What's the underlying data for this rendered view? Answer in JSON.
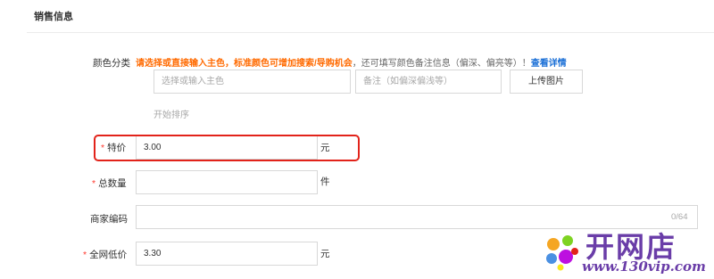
{
  "section": {
    "title": "销售信息"
  },
  "color_category": {
    "label": "颜色分类",
    "hint_orange": "请选择或直接输入主色，标准颜色可增加搜索/导购机会",
    "hint_gray": "，还可填写颜色备注信息（偏深、偏亮等）！",
    "hint_link": "查看详情",
    "main_color_placeholder": "选择或输入主色",
    "remark_placeholder": "备注（如偏深偏浅等）",
    "upload_button": "上传图片",
    "sort_link": "开始排序"
  },
  "special_price": {
    "required_mark": "*",
    "label": "特价",
    "value": "3.00",
    "unit": "元"
  },
  "total_quantity": {
    "required_mark": "*",
    "label": "总数量",
    "value": "",
    "unit": "件"
  },
  "merchant_code": {
    "label": "商家编码",
    "value": "",
    "counter": "0/64"
  },
  "lowest_price": {
    "required_mark": "*",
    "label": "全网低价",
    "value": "3.30",
    "unit": "元"
  },
  "watermark": {
    "text": "开网店",
    "url": "www.130vip.com"
  },
  "colors": {
    "accent_orange": "#ff6a00",
    "link_blue": "#1a6fd6",
    "required_red": "#ff3b30",
    "highlight_red": "#e2231a",
    "watermark_purple": "#6a3da8"
  }
}
